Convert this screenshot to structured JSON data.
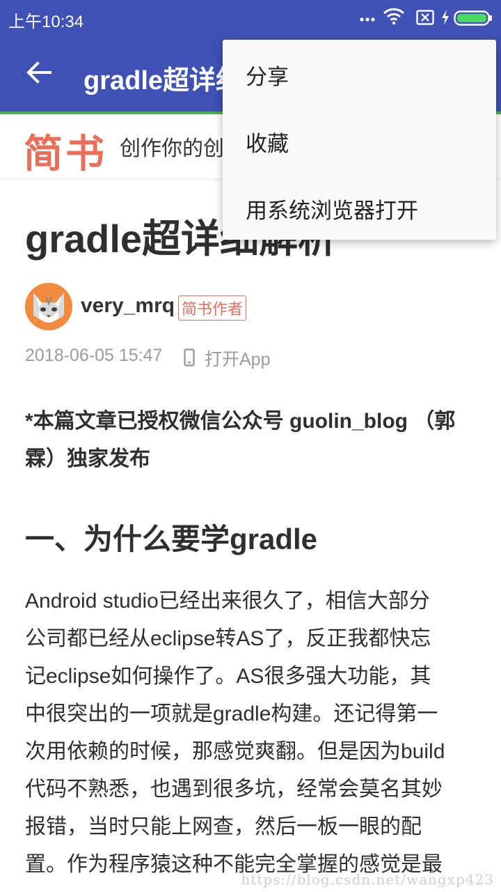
{
  "status_bar": {
    "time": "上午10:34",
    "icons": [
      "more-dots-icon",
      "wifi-icon",
      "sim-x-icon",
      "charging-icon",
      "battery-icon"
    ],
    "battery_color": "#4cd964"
  },
  "app_bar": {
    "title": "gradle超详细解析",
    "color": "#3f51b5"
  },
  "site_header": {
    "logo": "简书",
    "slogan": "创作你的创作",
    "logo_color": "#ea6f5a"
  },
  "article": {
    "title": "gradle超详细解析",
    "author": {
      "name": "very_mrq",
      "badge": "简书作者"
    },
    "date": "2018-06-05 15:47",
    "open_app": "打开App",
    "lede": "*本篇文章已授权微信公众号 guolin_blog （郭霖）独家发布",
    "section_heading": "一、为什么要学gradle",
    "paragraph_lines": [
      "Android studio已经出来很久了，相信大部分",
      "公司都已经从eclipse转AS了，反正我都快忘",
      "记eclipse如何操作了。AS很多强大功能，其",
      "中很突出的一项就是gradle构建。还记得第一",
      "次用依赖的时候，那感觉爽翻。但是因为build",
      "代码不熟悉，也遇到很多坑，经常会莫名其妙",
      "报错，当时只能上网查，然后一板一眼的配",
      "置。作为程序猿这种不能完全掌握的感觉是最"
    ]
  },
  "menu": {
    "items": [
      "分享",
      "收藏",
      "用系统浏览器打开"
    ]
  },
  "watermark": "https://blog.csdn.net/wangxp423"
}
